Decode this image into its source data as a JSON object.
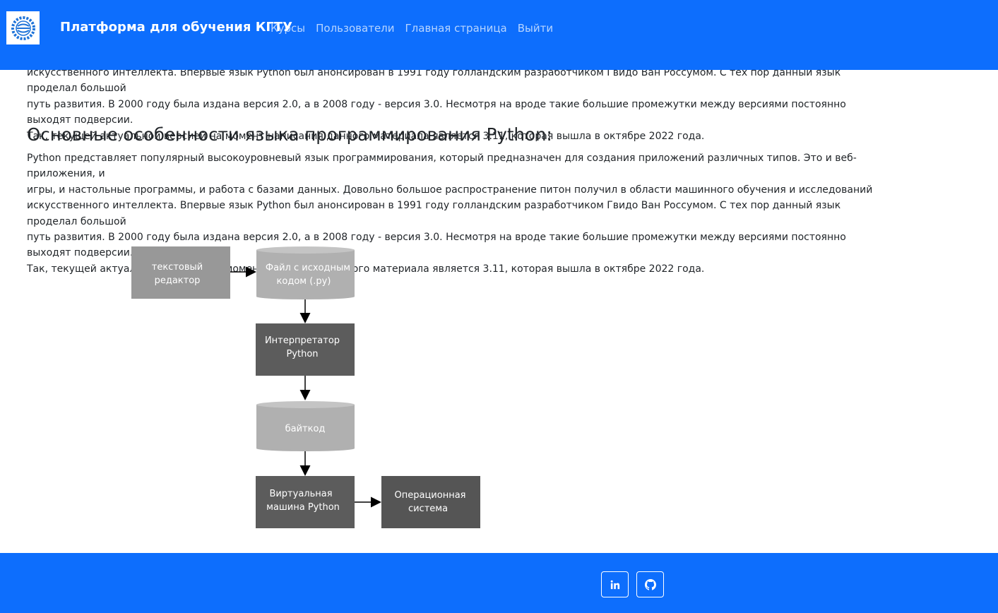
{
  "navbar": {
    "brand": "Платформа для обучения КГТУ",
    "links": [
      "Курсы",
      "Пользователи",
      "Главная страница",
      "Выйти"
    ]
  },
  "article": {
    "top_paragraph_lines": [
      "искусственного интеллекта. Впервые язык Python был анонсирован в 1991 году голландским разработчиком Гвидо Ван Россумом. С тех пор данный язык проделал большой",
      "путь развития. В 2000 году была издана версия 2.0, а в 2008 году - версия 3.0. Несмотря на вроде такие большие промежутки между версиями постоянно выходят подверсии.",
      "Так, текущей актуальной версией на момент написания данного материала является 3.11, которая вышла в октябре 2022 года."
    ],
    "heading": "Основные особенности языка программирования Python:",
    "paragraph_lines": [
      "Python представляет популярный высокоуровневый язык программирования, который предназначен для создания приложений различных типов. Это и веб-приложения, и",
      "игры, и настольные программы, и работа с базами данных. Довольно большое распространение питон получил в области машинного обучения и исследований",
      "искусственного интеллекта. Впервые язык Python был анонсирован в 1991 году голландским разработчиком Гвидо Ван Россумом. С тех пор данный язык проделал большой",
      "путь развития. В 2000 году была издана версия 2.0, а в 2008 году - версия 3.0. Несмотря на вроде такие большие промежутки между версиями постоянно выходят подверсии.",
      "Так, текущей актуальной версией на момент написания данного материала является 3.11, которая вышла в октябре 2022 года."
    ]
  },
  "diagram": {
    "nodes": [
      {
        "line1": "текстовый",
        "line2": "редактор"
      },
      {
        "line1": "Файл с исходным",
        "line2": "кодом (.py)"
      },
      {
        "line1": "Интерпретатор",
        "line2": "Python"
      },
      {
        "line1": "байткод",
        "line2": ""
      },
      {
        "line1": "Виртуальная",
        "line2": "машина Python"
      },
      {
        "line1": "Операционная",
        "line2": "система"
      }
    ]
  },
  "footer": {
    "icons": [
      "linkedin-icon",
      "github-icon"
    ]
  },
  "colors": {
    "primary": "#0d6efd",
    "box_light": "#9e9e9e",
    "box_dark": "#5a5a5a"
  }
}
